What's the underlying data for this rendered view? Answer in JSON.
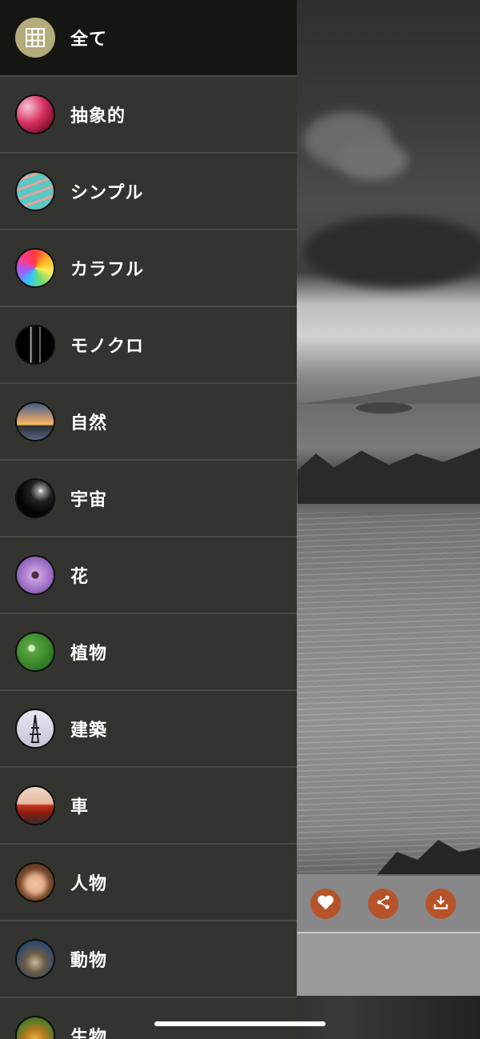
{
  "drawer": {
    "items": [
      {
        "label": "全て",
        "icon": "grid-icon",
        "selected": true
      },
      {
        "label": "抽象的",
        "icon": "abstract-thumb"
      },
      {
        "label": "シンプル",
        "icon": "simple-thumb"
      },
      {
        "label": "カラフル",
        "icon": "colorful-thumb"
      },
      {
        "label": "モノクロ",
        "icon": "monochrome-thumb"
      },
      {
        "label": "自然",
        "icon": "nature-thumb"
      },
      {
        "label": "宇宙",
        "icon": "space-thumb"
      },
      {
        "label": "花",
        "icon": "flower-thumb"
      },
      {
        "label": "植物",
        "icon": "plant-thumb"
      },
      {
        "label": "建築",
        "icon": "architecture-thumb"
      },
      {
        "label": "車",
        "icon": "car-thumb"
      },
      {
        "label": "人物",
        "icon": "person-thumb"
      },
      {
        "label": "動物",
        "icon": "animal-thumb"
      },
      {
        "label": "生物",
        "icon": "creature-thumb"
      }
    ]
  },
  "actions": [
    {
      "icon": "heart-icon"
    },
    {
      "icon": "share-icon"
    },
    {
      "icon": "download-icon"
    }
  ],
  "colors": {
    "drawer_bg": "#333330",
    "selected_bg": "#151511",
    "accent": "#b7532a",
    "grid_icon_bg": "#b3ab7a"
  }
}
